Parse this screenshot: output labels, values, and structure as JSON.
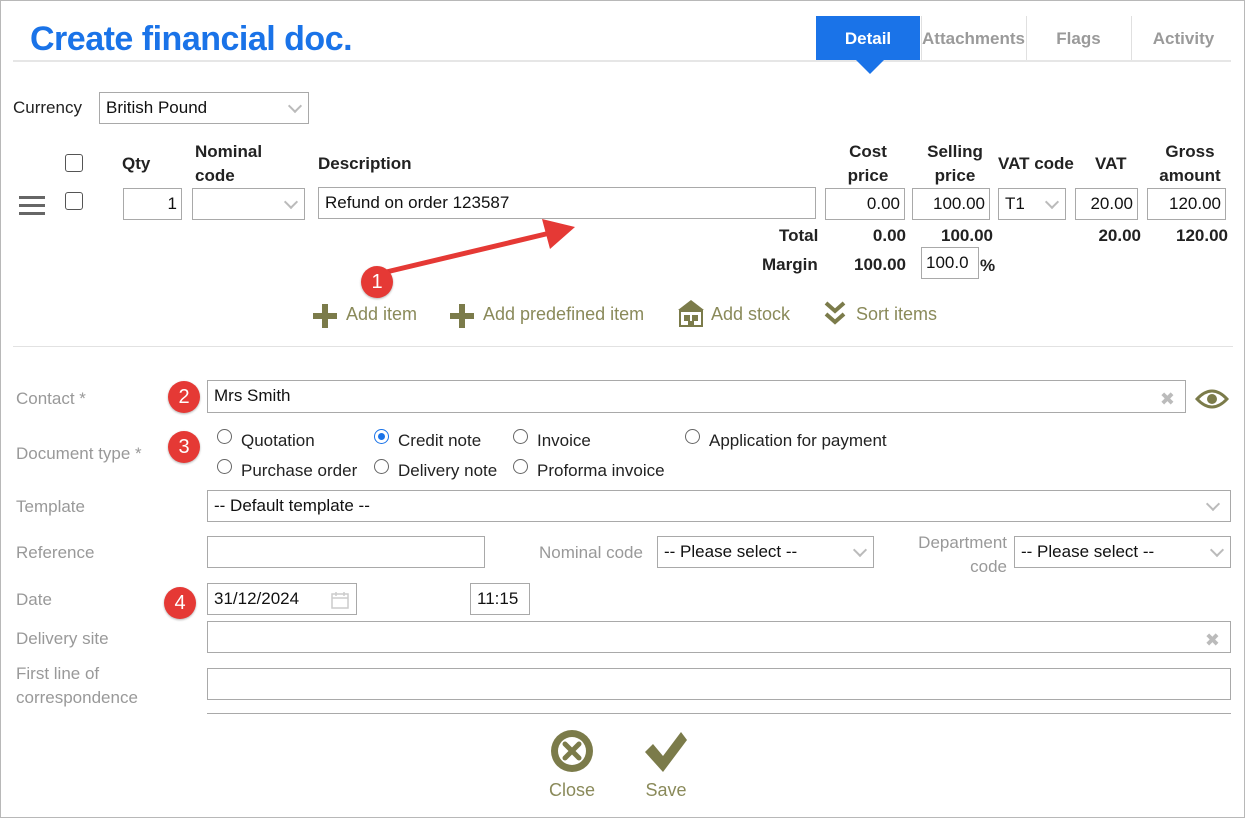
{
  "page": {
    "title": "Create financial doc."
  },
  "tabs": [
    {
      "label": "Detail"
    },
    {
      "label": "Attachments"
    },
    {
      "label": "Flags"
    },
    {
      "label": "Activity"
    }
  ],
  "currency": {
    "label": "Currency",
    "value": "British Pound"
  },
  "items_table": {
    "headers": {
      "qty": "Qty",
      "nominal_code_1": "Nominal",
      "nominal_code_2": "code",
      "description": "Description",
      "cost_price_1": "Cost",
      "cost_price_2": "price",
      "selling_price_1": "Selling",
      "selling_price_2": "price",
      "vat_code": "VAT code",
      "vat": "VAT",
      "gross_amount_1": "Gross",
      "gross_amount_2": "amount"
    },
    "row": {
      "qty": "1",
      "nominal_code": "",
      "description": "Refund on order 123587",
      "cost_price": "0.00",
      "selling_price": "100.00",
      "vat_code": "T1",
      "vat": "20.00",
      "gross_amount": "120.00"
    },
    "totals": {
      "label": "Total",
      "cost_price": "0.00",
      "selling_price": "100.00",
      "vat": "20.00",
      "gross_amount": "120.00"
    },
    "margin": {
      "label": "Margin",
      "amount": "100.00",
      "percent": "100.0",
      "percent_sign": "%"
    }
  },
  "item_actions": [
    {
      "label": "Add item",
      "icon": "plus-icon"
    },
    {
      "label": "Add predefined item",
      "icon": "plus-icon"
    },
    {
      "label": "Add stock",
      "icon": "stock-icon"
    },
    {
      "label": "Sort items",
      "icon": "double-chevron-down-icon"
    }
  ],
  "form": {
    "contact": {
      "label": "Contact *",
      "value": "Mrs Smith"
    },
    "document_type": {
      "label": "Document type *",
      "options": [
        "Quotation",
        "Credit note",
        "Invoice",
        "Application for payment",
        "Purchase order",
        "Delivery note",
        "Proforma invoice"
      ],
      "selected": "Credit note"
    },
    "template": {
      "label": "Template",
      "value": "-- Default template --"
    },
    "reference": {
      "label": "Reference",
      "value": ""
    },
    "nominal_code": {
      "label": "Nominal code",
      "value": "-- Please select --"
    },
    "department_code": {
      "label_1": "Department",
      "label_2": "code",
      "value": "-- Please select --"
    },
    "date": {
      "label": "Date",
      "value": "31/12/2024",
      "time": "11:15"
    },
    "delivery_site": {
      "label": "Delivery site",
      "value": ""
    },
    "first_line": {
      "label_1": "First line of",
      "label_2": "correspondence",
      "value": ""
    }
  },
  "annotations": [
    "1",
    "2",
    "3",
    "4"
  ],
  "footer": {
    "close_label": "Close",
    "save_label": "Save"
  },
  "colors": {
    "accent": "#1a73e8",
    "badge": "#e53935",
    "arrow": "#e53935",
    "action_olive": "#7b7b4a"
  }
}
